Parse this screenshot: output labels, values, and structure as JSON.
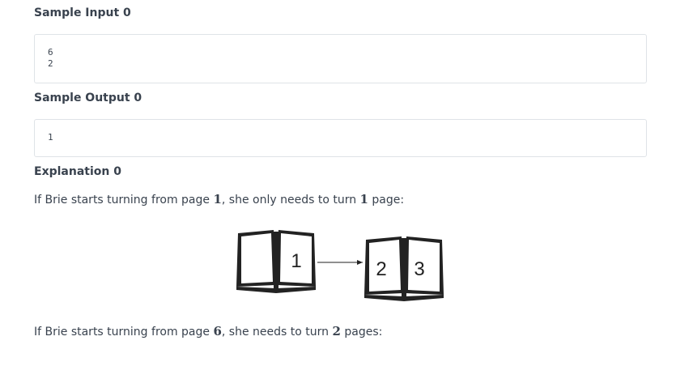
{
  "sample_input": {
    "heading": "Sample Input 0",
    "lines": "6\n2"
  },
  "sample_output": {
    "heading": "Sample Output 0",
    "lines": "1"
  },
  "explanation": {
    "heading": "Explanation 0",
    "para1": {
      "before": "If Brie starts turning from page ",
      "page": "1",
      "middle": ", she only needs to turn ",
      "count": "1",
      "after": " page:"
    },
    "figure": {
      "book1_page": "1",
      "book2_left_page": "2",
      "book2_right_page": "3"
    },
    "para2": {
      "before": "If Brie starts turning from page ",
      "page": "6",
      "middle": ", she needs to turn ",
      "count": "2",
      "after": " pages:"
    }
  }
}
